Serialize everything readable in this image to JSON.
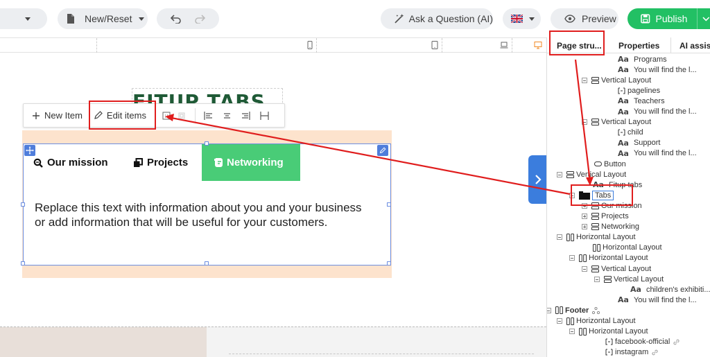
{
  "topbar": {
    "page_select_caret": "▾",
    "new_reset_label": "New/Reset",
    "ask_label": "Ask a Question (AI)",
    "preview_label": "Preview",
    "publish_label": "Publish",
    "language_flag": "uk-flag-icon"
  },
  "canvas": {
    "heading_text": "FITUP TABS",
    "toolbar": {
      "new_item_label": "New Item",
      "edit_items_label": "Edit items"
    },
    "tabs": [
      {
        "label": "Our mission",
        "icon": "search-icon"
      },
      {
        "label": "Projects",
        "icon": "copy-icon"
      },
      {
        "label": "Networking",
        "icon": "evernote-icon",
        "active": true
      }
    ],
    "tab_content": "Replace this text with information about you and your business or add information that will be useful for your customers."
  },
  "panel": {
    "tabs": [
      "Page stru...",
      "Properties",
      "AI assist"
    ],
    "tree": [
      {
        "label": "Programs",
        "icon": "text-icon"
      },
      {
        "label": "You will find the l...",
        "icon": "text-icon"
      },
      {
        "label": "Vertical Layout",
        "icon": "vertical-layout-icon"
      },
      {
        "label": "pagelines",
        "icon": "embed-icon"
      },
      {
        "label": "Teachers",
        "icon": "text-icon"
      },
      {
        "label": "You will find the l...",
        "icon": "text-icon"
      },
      {
        "label": "Vertical Layout",
        "icon": "vertical-layout-icon"
      },
      {
        "label": "child",
        "icon": "embed-icon"
      },
      {
        "label": "Support",
        "icon": "text-icon"
      },
      {
        "label": "You will find the l...",
        "icon": "text-icon"
      },
      {
        "label": "Button",
        "icon": "button-icon"
      },
      {
        "label": "Vertical Layout",
        "icon": "vertical-layout-icon"
      },
      {
        "label": "Fitup tabs",
        "icon": "text-icon"
      },
      {
        "label": "Tabs",
        "icon": "tabs-icon"
      },
      {
        "label": "Our mission",
        "icon": "vertical-layout-icon"
      },
      {
        "label": "Projects",
        "icon": "vertical-layout-icon"
      },
      {
        "label": "Networking",
        "icon": "vertical-layout-icon"
      },
      {
        "label": "Horizontal Layout",
        "icon": "horizontal-layout-icon"
      },
      {
        "label": "Horizontal Layout",
        "icon": "horizontal-layout-icon"
      },
      {
        "label": "Horizontal Layout",
        "icon": "horizontal-layout-icon"
      },
      {
        "label": "Vertical Layout",
        "icon": "vertical-layout-icon"
      },
      {
        "label": "Vertical Layout",
        "icon": "vertical-layout-icon"
      },
      {
        "label": "children's exhibiti...",
        "icon": "text-icon"
      },
      {
        "label": "You will find the l...",
        "icon": "text-icon"
      },
      {
        "label": "Footer",
        "icon": "horizontal-layout-icon"
      },
      {
        "label": "Horizontal Layout",
        "icon": "horizontal-layout-icon"
      },
      {
        "label": "Horizontal Layout",
        "icon": "horizontal-layout-icon"
      },
      {
        "label": "facebook-official",
        "icon": "embed-icon"
      },
      {
        "label": "instagram",
        "icon": "embed-icon"
      }
    ]
  },
  "colors": {
    "publish_green": "#22c064",
    "active_tab_green": "#49cc77",
    "selection_blue": "#3b7ddd",
    "annotation_red": "#e01d1d",
    "section_peach": "#fde3cd"
  }
}
